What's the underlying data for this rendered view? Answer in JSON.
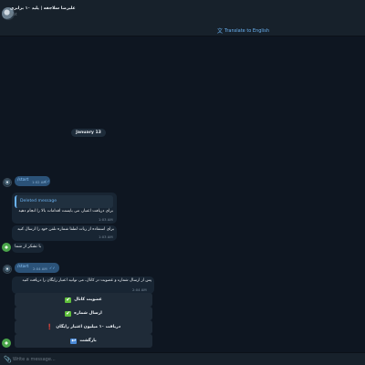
{
  "header": {
    "title": "علیرضا سلاجقه | پلید ۱۰ برابری",
    "subtitle": "bot",
    "translate_label": "Translate to English"
  },
  "chat": {
    "date": "January 13",
    "messages": [
      {
        "text": "/start",
        "time": "1:02 AM"
      },
      {
        "deleted_label": "Deleted message",
        "text": "برای دریافت اعتبار، می بایست اقدامات بالا را انجام دهید",
        "time": "1:03 AM"
      },
      {
        "text": "برای استفاده از ربات لطفا شماره تلفن خود را ارسال کنید",
        "time": "1:03 AM"
      },
      {
        "text": "با تشکر از شما"
      },
      {
        "text": "/start",
        "time": "2:04 AM"
      },
      {
        "text": "پس از ارسال شماره و عضویت در کانال، می توانید اعتبار رایگان را دریافت کنید",
        "time": "2:04 AM"
      }
    ],
    "keyboard": [
      {
        "label": "عضویت کانال",
        "emoji": "✔"
      },
      {
        "label": "ارسال شماره",
        "emoji": "✔"
      },
      {
        "label": "دریافت ۱۰ میلیون اعتبار رایگان",
        "emoji": "❗"
      },
      {
        "label": "بازگشت",
        "emoji": "↩"
      }
    ]
  },
  "composer": {
    "placeholder": "Write a message..."
  },
  "colors": {
    "background": "#0e1621",
    "header": "#17212b",
    "outgoing_bubble": "#2b5278",
    "incoming_bubble": "#182533",
    "link": "#6ab2f2"
  }
}
